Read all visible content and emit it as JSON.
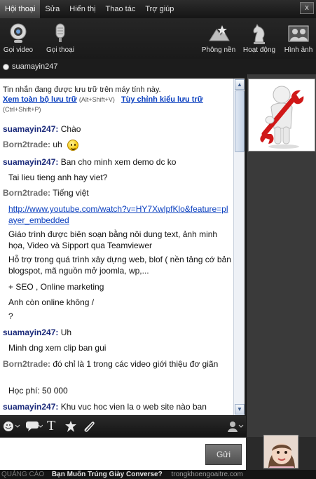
{
  "menu": {
    "items": [
      "Hội thoại",
      "Sửa",
      "Hiển thị",
      "Thao tác",
      "Trợ giúp"
    ],
    "close": "x"
  },
  "toolbar": {
    "video_call": "Gọi video",
    "voice_call": "Gọi thoại",
    "background": "Phông nền",
    "activities": "Hoạt động",
    "photos": "Hình ảnh"
  },
  "contact": {
    "name": "suamayin247"
  },
  "notice": {
    "text": "Tin nhắn đang được lưu trữ trên máy tính này.",
    "view_link": "Xem toàn bộ lưu trữ",
    "view_shortcut": "(Alt+Shift+V)",
    "custom_link": "Tùy chỉnh kiểu lưu trữ",
    "custom_shortcut": "(Ctrl+Shift+P)"
  },
  "messages": [
    {
      "sender": "suamayin247:",
      "text": "Chào"
    },
    {
      "sender": "Born2trade:",
      "text": "uh"
    },
    {
      "sender": "suamayin247:",
      "text": "Ban cho minh xem demo dc ko"
    },
    {
      "sender": "",
      "text": "Tai lieu tieng anh hay viet?"
    },
    {
      "sender": "Born2trade:",
      "text": "Tiếng việt"
    },
    {
      "sender": "",
      "text": "http://www.youtube.com/watch?v=HY7XwlpfKlo&feature=player_embedded"
    },
    {
      "sender": "",
      "text": "Giáo trình được biên soạn bằng nôi dung text, ảnh minh họa, Video và Sipport qua Teamviewer"
    },
    {
      "sender": "",
      "text": "Hỗ trợ trong quá trình xây dựng web, blof ( nền tảng cớ bản blogspot, mã nguồn mở joomla, wp,..."
    },
    {
      "sender": "",
      "text": "+ SEO , Online marketing"
    },
    {
      "sender": "",
      "text": "Anh còn online không /"
    },
    {
      "sender": "",
      "text": "?"
    },
    {
      "sender": "suamayin247:",
      "text": "Uh"
    },
    {
      "sender": "",
      "text": "Minh dng xem clip ban gui"
    },
    {
      "sender": "Born2trade:",
      "text": "đó chỉ là 1 trong các video giới thiệu đơ giãn"
    },
    {
      "sender": "",
      "text": "Học phí: 50 000"
    },
    {
      "sender": "suamayin247:",
      "text": "Khu vuc hoc vien la o web site nào ban"
    }
  ],
  "compose": {
    "send": "Gửi"
  },
  "ad": {
    "label": "QUẢNG CÁO",
    "title": "Bạn Muốn Trúng Giày Converse?",
    "url": "trongkhoengoaitre.com"
  },
  "colors": {
    "link": "#0a3fbf",
    "sender_me": "#1b2a7a",
    "sender_other": "#6b6b6b"
  }
}
